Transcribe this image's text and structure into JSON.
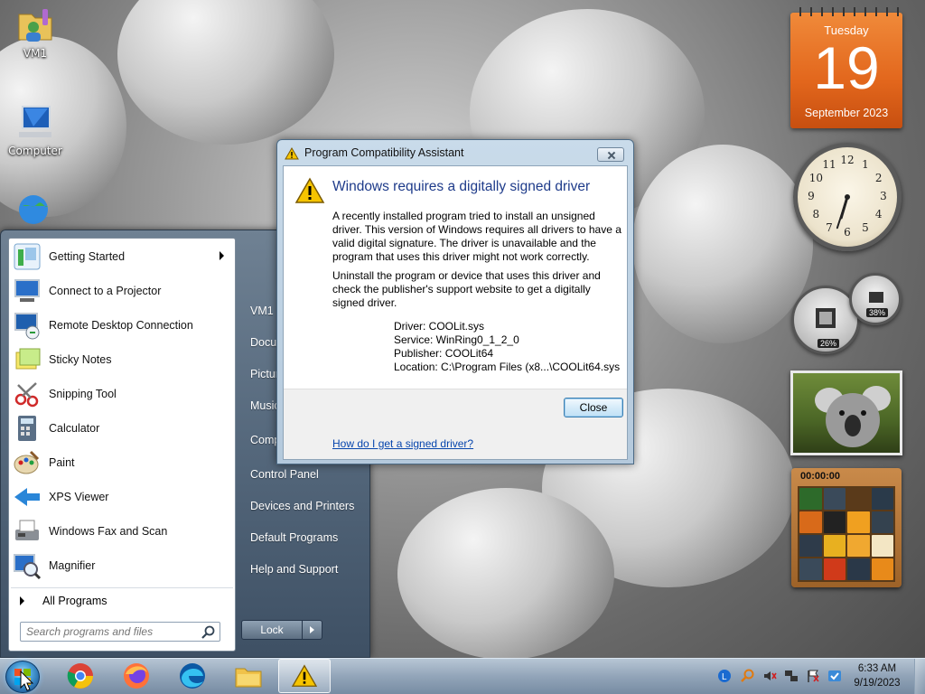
{
  "desktop": {
    "icons": [
      {
        "label": "VM1",
        "icon": "user-folder-icon"
      },
      {
        "label": "Computer",
        "icon": "computer-icon"
      },
      {
        "label": "",
        "icon": "network-globe-icon"
      }
    ]
  },
  "start_menu": {
    "programs": [
      {
        "label": "Getting Started",
        "icon": "getting-started-icon",
        "has_submenu": true
      },
      {
        "label": "Connect to a Projector",
        "icon": "projector-icon"
      },
      {
        "label": "Remote Desktop Connection",
        "icon": "remote-desktop-icon"
      },
      {
        "label": "Sticky Notes",
        "icon": "sticky-notes-icon"
      },
      {
        "label": "Snipping Tool",
        "icon": "scissors-icon"
      },
      {
        "label": "Calculator",
        "icon": "calculator-icon"
      },
      {
        "label": "Paint",
        "icon": "paint-palette-icon"
      },
      {
        "label": "XPS Viewer",
        "icon": "xps-viewer-icon"
      },
      {
        "label": "Windows Fax and Scan",
        "icon": "fax-icon"
      },
      {
        "label": "Magnifier",
        "icon": "magnifier-icon"
      }
    ],
    "all_programs": "All Programs",
    "search_placeholder": "Search programs and files",
    "right_links": [
      "VM1",
      "Documents",
      "Pictures",
      "Music",
      "Computer",
      "Control Panel",
      "Devices and Printers",
      "Default Programs",
      "Help and Support"
    ],
    "lock_label": "Lock"
  },
  "dialog": {
    "title": "Program Compatibility Assistant",
    "heading": "Windows requires a digitally signed driver",
    "para1": [
      "A recently installed program tried to install an unsigned",
      "driver. This version of Windows requires all drivers to have a",
      "valid digital signature. The driver is unavailable and the",
      "program that uses this driver might not work correctly."
    ],
    "para2": [
      "Uninstall the program or device that uses this driver and",
      "check the publisher's support website to get a digitally",
      "signed driver."
    ],
    "details": {
      "driver": "Driver: COOLit.sys",
      "service": "Service: WinRing0_1_2_0",
      "publisher": "Publisher: COOLit64",
      "location": "Location: C:\\Program Files (x8...\\COOLit64.sys"
    },
    "close_label": "Close",
    "help_link": "How do I get a signed driver?"
  },
  "gadgets": {
    "calendar": {
      "weekday": "Tuesday",
      "day": "19",
      "month_year": "September 2023"
    },
    "clock": {
      "numbers": [
        "12",
        "1",
        "2",
        "3",
        "4",
        "5",
        "6",
        "7",
        "8",
        "9",
        "10",
        "11"
      ],
      "hour": 6,
      "minute": 33
    },
    "cpu_meter": {
      "cpu": "26%",
      "memory": "38%"
    },
    "puzzle": {
      "timer": "00:00:00"
    }
  },
  "taskbar": {
    "pinned": [
      {
        "name": "start-orb",
        "icon": "windows-logo-icon"
      },
      {
        "name": "chrome",
        "icon": "chrome-icon"
      },
      {
        "name": "firefox",
        "icon": "firefox-icon"
      },
      {
        "name": "edge",
        "icon": "edge-icon"
      },
      {
        "name": "explorer",
        "icon": "folder-icon"
      },
      {
        "name": "warning-app",
        "icon": "warning-icon",
        "active": true
      }
    ],
    "time": "6:33 AM",
    "date": "9/19/2023"
  },
  "colors": {
    "dialog_heading": "#1e3b8a",
    "calendar": "#e2661c",
    "link": "#0645ad"
  }
}
